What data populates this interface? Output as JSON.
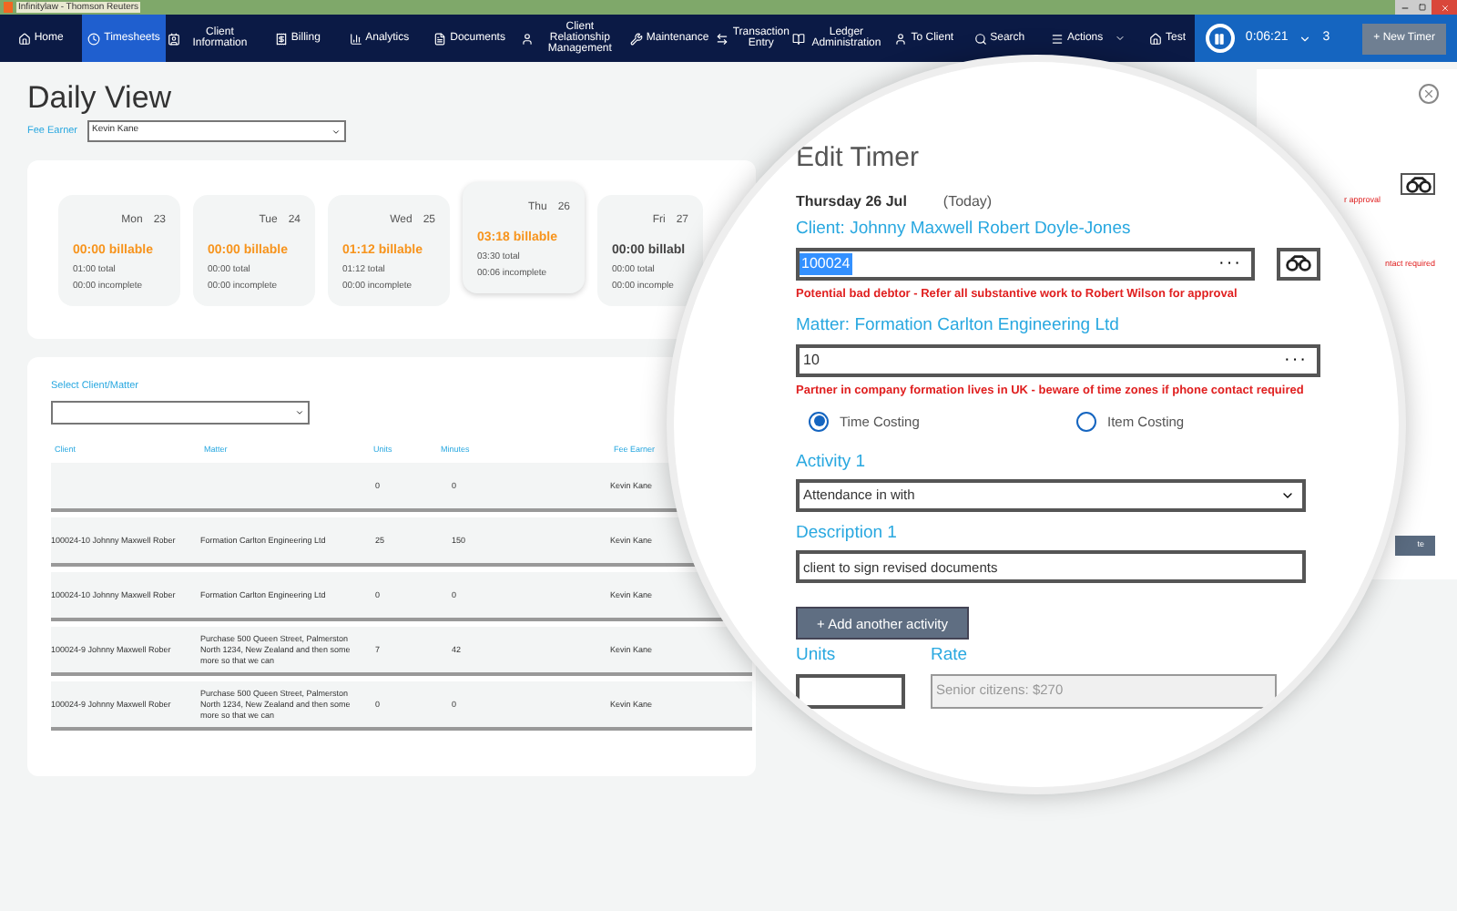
{
  "window": {
    "title": "Infinitylaw - Thomson Reuters"
  },
  "nav": {
    "items": [
      {
        "label": "Home",
        "selected": false
      },
      {
        "label": "Timesheets",
        "selected": true
      },
      {
        "label": "Client Information",
        "selected": false
      },
      {
        "label": "Billing",
        "selected": false
      },
      {
        "label": "Analytics",
        "selected": false
      },
      {
        "label": "Documents",
        "selected": false
      },
      {
        "label": "Client Relationship Management",
        "selected": false
      },
      {
        "label": "Maintenance",
        "selected": false
      },
      {
        "label": "Transaction Entry",
        "selected": false
      },
      {
        "label": "Ledger Administration",
        "selected": false
      },
      {
        "label": "To Client",
        "selected": false
      },
      {
        "label": "Search",
        "selected": false
      },
      {
        "label": "Actions",
        "selected": false
      },
      {
        "label": "Test",
        "selected": false
      }
    ],
    "timer": {
      "elapsed": "0:06:21",
      "count": "3",
      "new_button": "+ New Timer"
    }
  },
  "page": {
    "title": "Daily View",
    "fee_earner_label": "Fee Earner",
    "fee_earner_value": "Kevin Kane"
  },
  "days": [
    {
      "day": "Mon",
      "date": "23",
      "billable": "00:00 billable",
      "color": "#f7941d",
      "total": "01:00 total",
      "incomplete": "00:00 incomplete",
      "selected": false
    },
    {
      "day": "Tue",
      "date": "24",
      "billable": "00:00 billable",
      "color": "#f7941d",
      "total": "00:00 total",
      "incomplete": "00:00 incomplete",
      "selected": false
    },
    {
      "day": "Wed",
      "date": "25",
      "billable": "01:12 billable",
      "color": "#f7941d",
      "total": "01:12 total",
      "incomplete": "00:00 incomplete",
      "selected": false
    },
    {
      "day": "Thu",
      "date": "26",
      "billable": "03:18 billable",
      "color": "#f7941d",
      "total": "03:30 total",
      "incomplete": "00:06 incomplete",
      "selected": true
    },
    {
      "day": "Fri",
      "date": "27",
      "billable": "00:00 billabl",
      "color": "#444444",
      "total": "00:00 total",
      "incomplete": "00:00 incomple",
      "selected": false
    }
  ],
  "table": {
    "filter_label": "Select Client/Matter",
    "columns": [
      "Client",
      "Matter",
      "Units",
      "Minutes",
      "Fee Earner"
    ],
    "rows": [
      [
        "",
        "",
        "0",
        "0",
        "Kevin Kane"
      ],
      [
        "100024-10 Johnny Maxwell Rober",
        "Formation Carlton Engineering Ltd",
        "25",
        "150",
        "Kevin Kane"
      ],
      [
        "100024-10 Johnny Maxwell Rober",
        "Formation Carlton Engineering Ltd",
        "0",
        "0",
        "Kevin Kane"
      ],
      [
        "100024-9 Johnny Maxwell Rober",
        "Purchase 500 Queen Street, Palmerston North 1234, New Zealand and then some more so that we can",
        "7",
        "42",
        "Kevin Kane"
      ],
      [
        "100024-9 Johnny Maxwell Rober",
        "Purchase 500 Queen Street, Palmerston North 1234, New Zealand and then some more so that we can",
        "0",
        "0",
        "Kevin Kane"
      ]
    ]
  },
  "background_dialog": {
    "warning_1": "r approval",
    "warning_2": "ntact required",
    "button": "te"
  },
  "edit_timer": {
    "title": "Edit Timer",
    "date": "Thursday 26 Jul",
    "today": "(Today)",
    "client_label": "Client: Johnny Maxwell Robert Doyle-Jones",
    "client_value": "100024",
    "client_more": "···",
    "client_warning": "Potential bad debtor - Refer all substantive work to Robert Wilson for approval",
    "matter_label": "Matter: Formation Carlton Engineering Ltd",
    "matter_value": "10",
    "matter_more": "···",
    "matter_warning": "Partner in company formation lives in UK - beware of time zones if phone contact required",
    "costing": [
      {
        "label": "Time Costing",
        "selected": true
      },
      {
        "label": "Item Costing",
        "selected": false
      }
    ],
    "activity_label": "Activity 1",
    "activity_value": "Attendance in with",
    "description_label": "Description 1",
    "description_value": "client to sign revised documents",
    "add_button": "+ Add another activity",
    "units_label": "Units",
    "rate_label": "Rate",
    "rate_value": "Senior citizens: $270"
  }
}
